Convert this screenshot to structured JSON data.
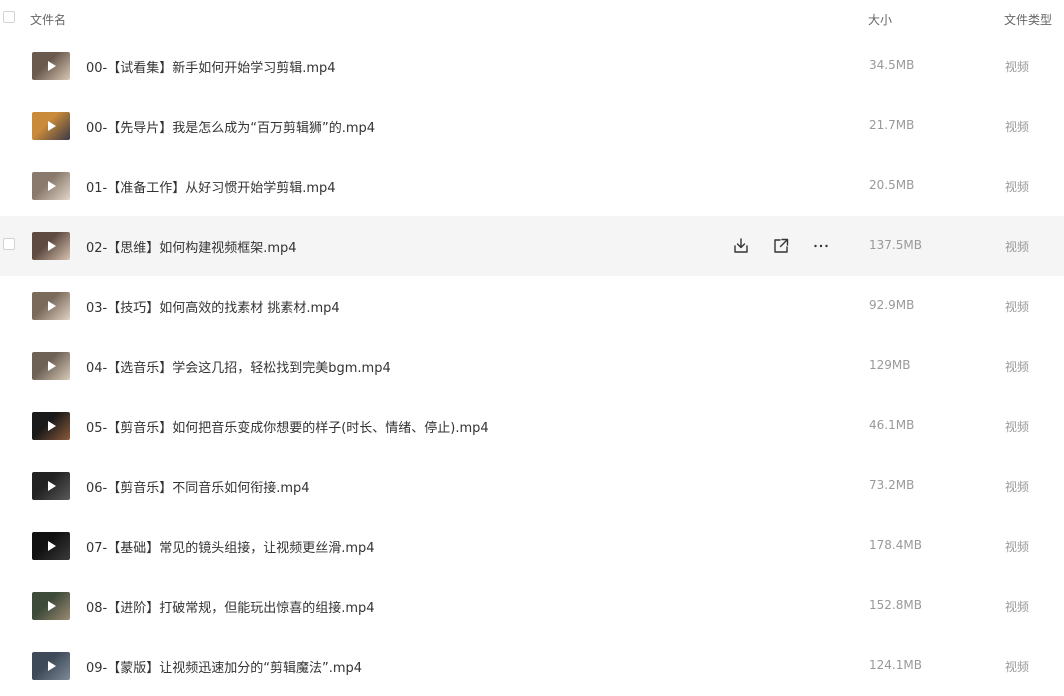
{
  "header": {
    "name_label": "文件名",
    "size_label": "大小",
    "type_label": "文件类型"
  },
  "colors": {
    "hover_row_bg": "#f5f5f5",
    "meta_text": "#999999"
  },
  "row_actions": {
    "icons": [
      "download-icon",
      "share-icon",
      "more-icon"
    ]
  },
  "files": [
    {
      "name": "00-【试看集】新手如何开始学习剪辑.mp4",
      "size": "34.5MB",
      "type": "视频",
      "thumb": [
        "#6a5a4e",
        "#d9c7b4"
      ]
    },
    {
      "name": "00-【先导片】我是怎么成为“百万剪辑狮”的.mp4",
      "size": "21.7MB",
      "type": "视频",
      "thumb": [
        "#c98a3a",
        "#3a3a46"
      ]
    },
    {
      "name": "01-【准备工作】从好习惯开始学剪辑.mp4",
      "size": "20.5MB",
      "type": "视频",
      "thumb": [
        "#8a7a6e",
        "#e2d6c8"
      ]
    },
    {
      "name": "02-【思维】如何构建视频框架.mp4",
      "size": "137.5MB",
      "type": "视频",
      "thumb": [
        "#5e4a40",
        "#d7c3b0"
      ],
      "hover": true
    },
    {
      "name": "03-【技巧】如何高效的找素材 挑素材.mp4",
      "size": "92.9MB",
      "type": "视频",
      "thumb": [
        "#7a6a5c",
        "#e0d2c2"
      ]
    },
    {
      "name": "04-【选音乐】学会这几招，轻松找到完美bgm.mp4",
      "size": "129MB",
      "type": "视频",
      "thumb": [
        "#6e6256",
        "#d8cab8"
      ]
    },
    {
      "name": "05-【剪音乐】如何把音乐变成你想要的样子(时长、情绪、停止).mp4",
      "size": "46.1MB",
      "type": "视频",
      "thumb": [
        "#1a1a1a",
        "#8a5a3a"
      ]
    },
    {
      "name": "06-【剪音乐】不同音乐如何衔接.mp4",
      "size": "73.2MB",
      "type": "视频",
      "thumb": [
        "#222222",
        "#5a5a5a"
      ]
    },
    {
      "name": "07-【基础】常见的镜头组接，让视频更丝滑.mp4",
      "size": "178.4MB",
      "type": "视频",
      "thumb": [
        "#111111",
        "#3a3a3a"
      ]
    },
    {
      "name": "08-【进阶】打破常规，但能玩出惊喜的组接.mp4",
      "size": "152.8MB",
      "type": "视频",
      "thumb": [
        "#3e4a3a",
        "#9a8a72"
      ]
    },
    {
      "name": "09-【蒙版】让视频迅速加分的“剪辑魔法”.mp4",
      "size": "124.1MB",
      "type": "视频",
      "thumb": [
        "#3e4a58",
        "#7e8a98"
      ]
    }
  ]
}
